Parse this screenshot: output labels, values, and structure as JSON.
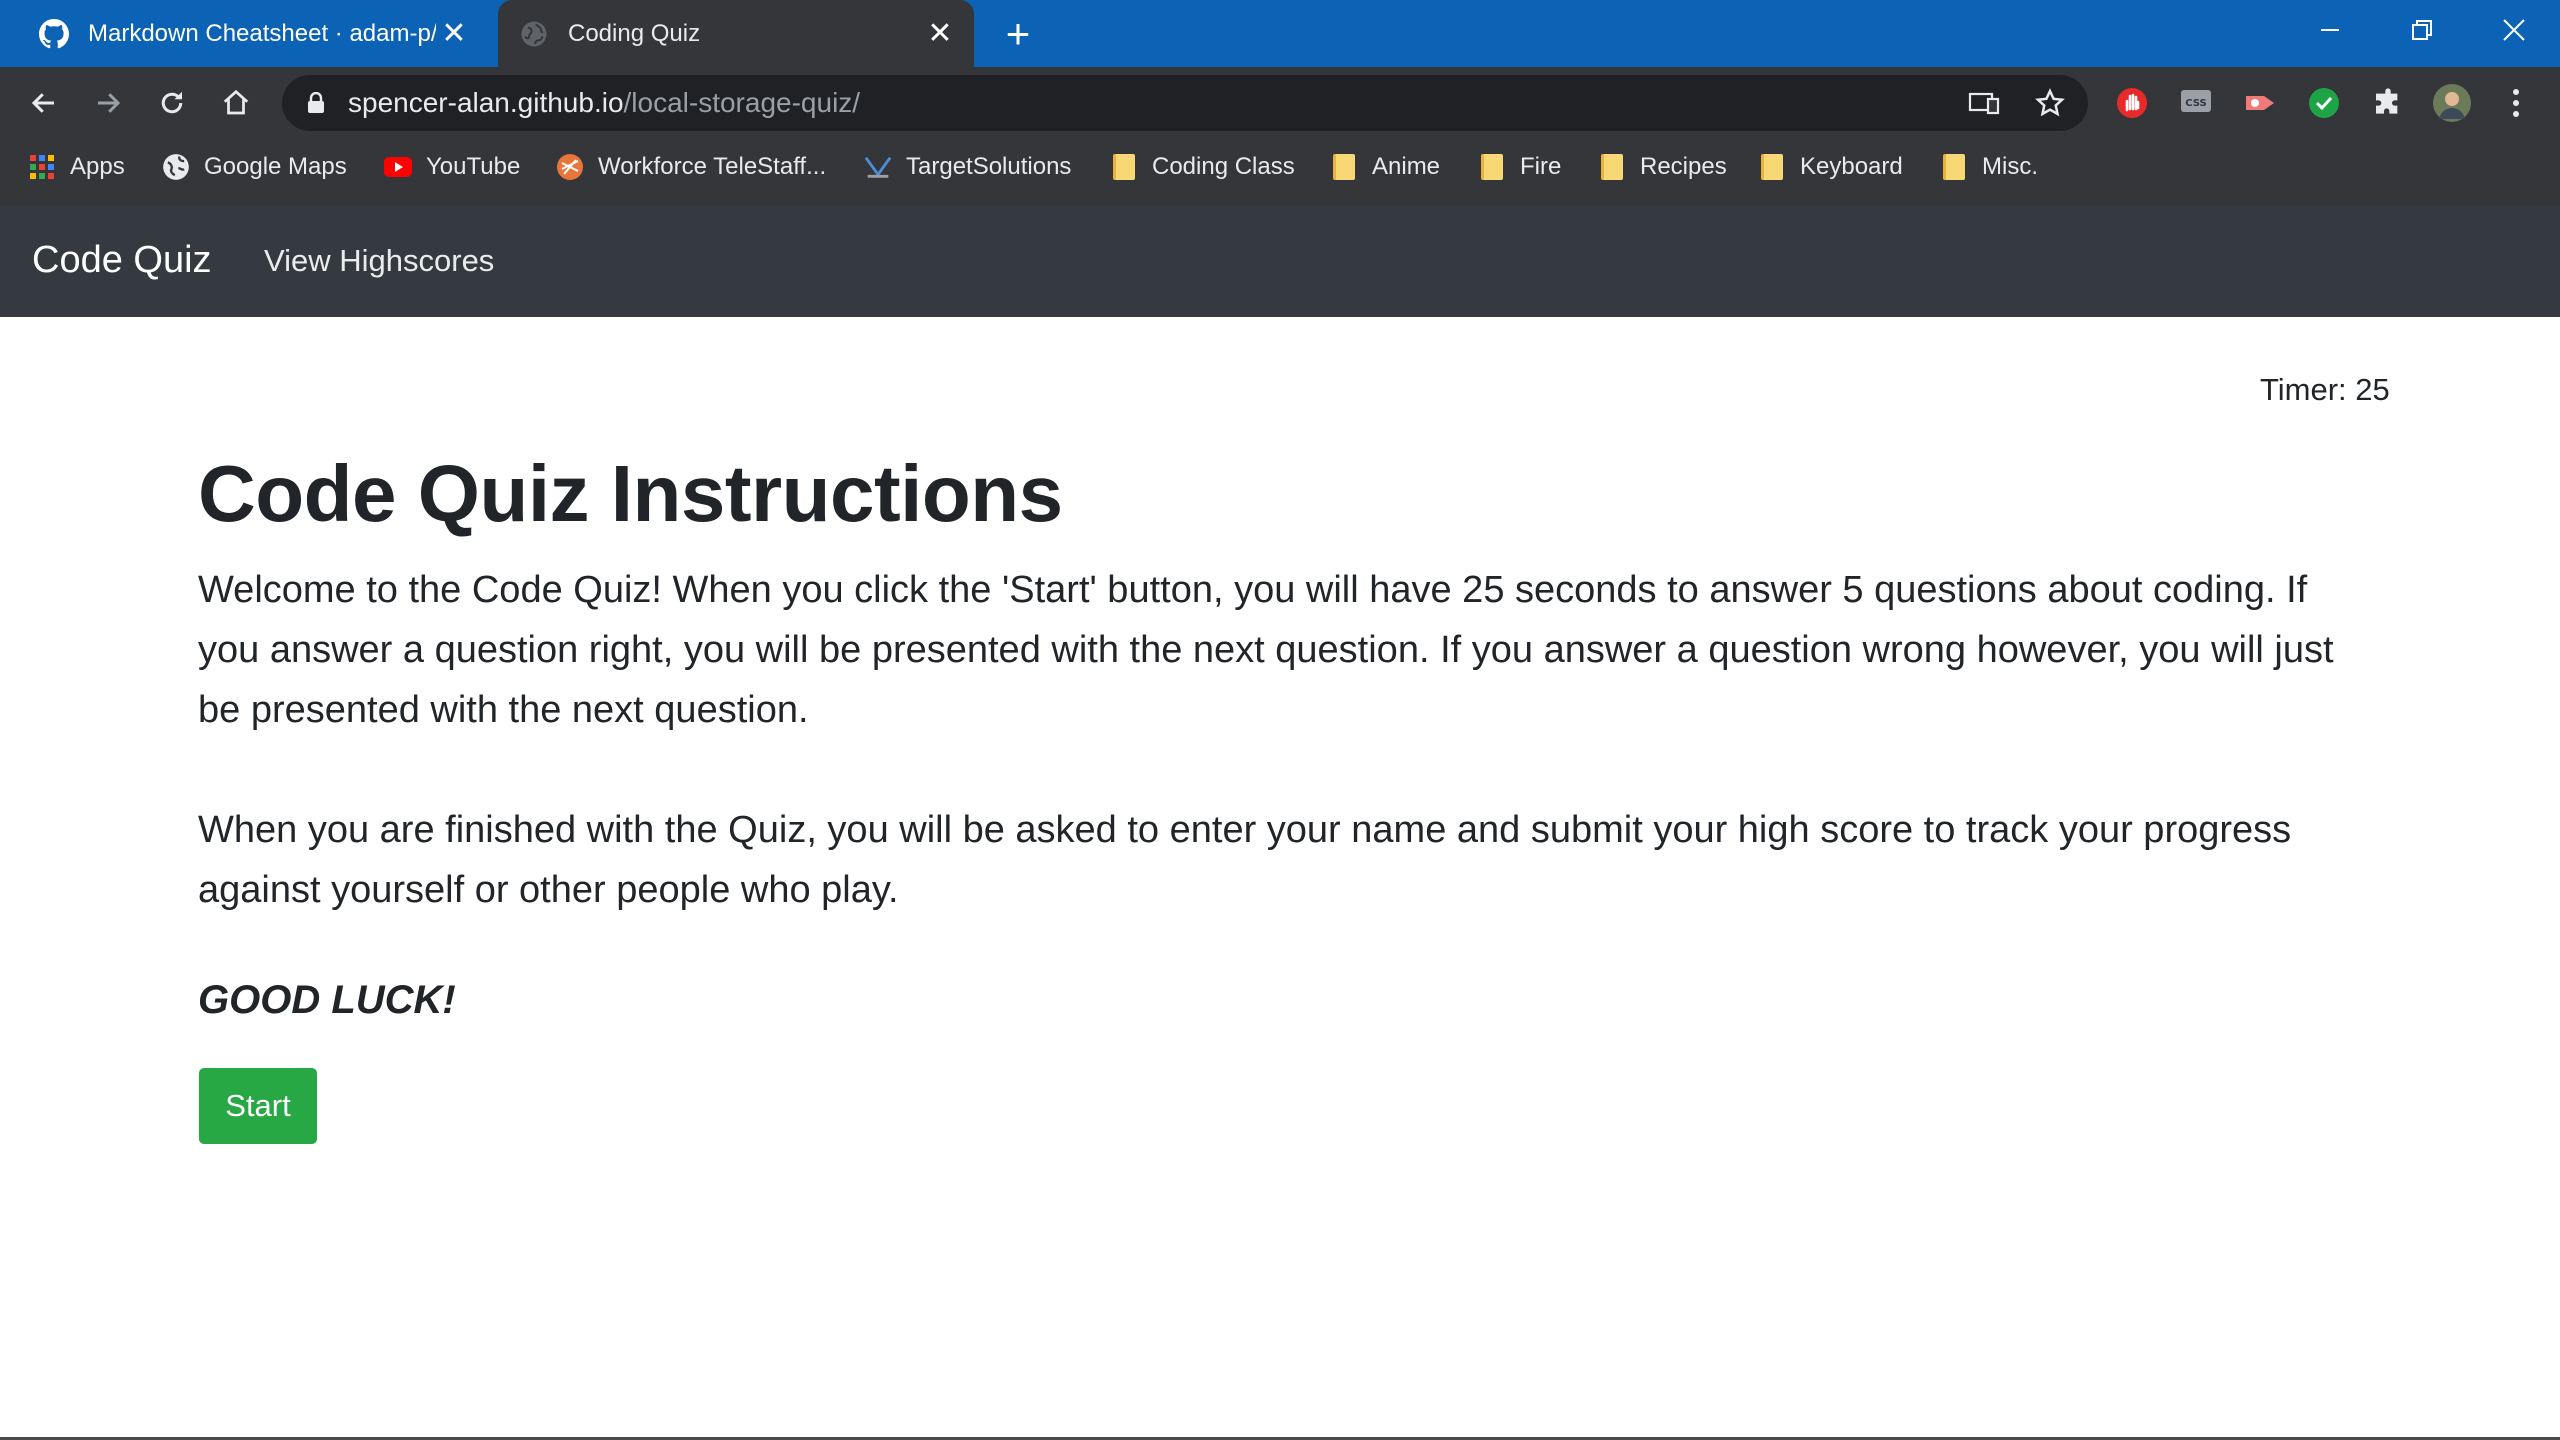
{
  "browser": {
    "tabs": [
      {
        "title": "Markdown Cheatsheet · adam-p/",
        "icon": "github-icon",
        "active": false
      },
      {
        "title": "Coding Quiz",
        "icon": "globe-icon",
        "active": true
      }
    ],
    "address_bar": {
      "domain": "spencer-alan.github.io",
      "path": "/local-storage-quiz/"
    },
    "bookmarks": [
      {
        "label": "Apps",
        "icon": "apps-grid-icon"
      },
      {
        "label": "Google Maps",
        "icon": "google-maps-icon"
      },
      {
        "label": "YouTube",
        "icon": "youtube-icon"
      },
      {
        "label": "Workforce TeleStaff...",
        "icon": "telestaff-icon"
      },
      {
        "label": "TargetSolutions",
        "icon": "targetsolutions-icon"
      },
      {
        "label": "Coding Class",
        "icon": "folder-icon"
      },
      {
        "label": "Anime",
        "icon": "folder-icon"
      },
      {
        "label": "Fire",
        "icon": "folder-icon"
      },
      {
        "label": "Recipes",
        "icon": "folder-icon"
      },
      {
        "label": "Keyboard",
        "icon": "folder-icon"
      },
      {
        "label": "Misc.",
        "icon": "folder-icon"
      }
    ],
    "colors": {
      "tabstrip": "#0c62b5",
      "toolbar": "#35363a",
      "omnibox": "#202124"
    }
  },
  "site": {
    "navbar": {
      "brand": "Code Quiz",
      "link": "View Highscores"
    },
    "timer": "Timer: 25",
    "heading": "Code Quiz Instructions",
    "paragraph1": "Welcome to the Code Quiz! When you click the 'Start' button, you will have 25 seconds to answer 5 questions about coding. If you answer a question right, you will be presented with the next question. If you answer a question wrong however, you will just be presented with the next question.",
    "paragraph2": "When you are finished with the Quiz, you will be asked to enter your name and submit your high score to track your progress against yourself or other people who play.",
    "good_luck": "GOOD LUCK!",
    "start_button": "Start",
    "colors": {
      "navbar": "#343a40",
      "start_button": "#28a745",
      "text": "#212529"
    }
  }
}
